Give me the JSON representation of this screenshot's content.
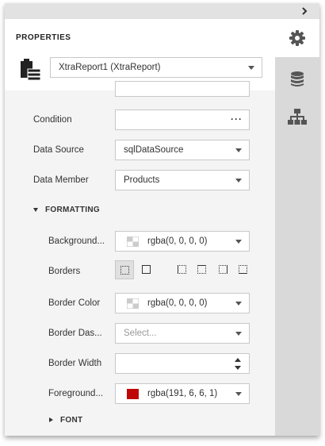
{
  "header": {
    "title": "PROPERTIES"
  },
  "report_selector": {
    "value": "XtraReport1 (XtraReport)"
  },
  "rail": {
    "icons": [
      "gear-icon",
      "database-icon",
      "hierarchy-icon"
    ]
  },
  "fields": {
    "condition": {
      "label": "Condition",
      "value": "···"
    },
    "data_source": {
      "label": "Data Source",
      "value": "sqlDataSource"
    },
    "data_member": {
      "label": "Data Member",
      "value": "Products"
    }
  },
  "formatting": {
    "title": "FORMATTING",
    "background": {
      "label": "Background...",
      "value": "rgba(0, 0, 0, 0)"
    },
    "borders": {
      "label": "Borders"
    },
    "border_color": {
      "label": "Border Color",
      "value": "rgba(0, 0, 0, 0)"
    },
    "border_dash": {
      "label": "Border Das...",
      "placeholder": "Select..."
    },
    "border_width": {
      "label": "Border Width",
      "value": ""
    },
    "foreground": {
      "label": "Foreground...",
      "value": "rgba(191, 6, 6, 1)",
      "swatch_color": "#bf0606"
    }
  },
  "font_section": {
    "title": "FONT"
  },
  "colors": {
    "accent": "#555555",
    "rail": "#d9d9d9"
  }
}
